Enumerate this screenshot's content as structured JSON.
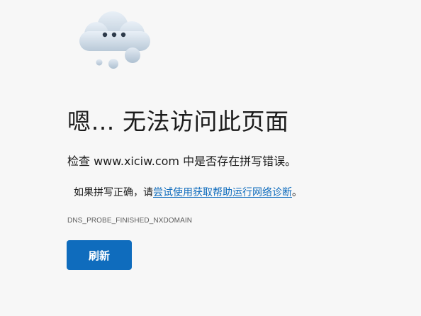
{
  "page": {
    "title": "嗯… 无法访问此页面",
    "check_line": "检查 www.xiciw.com 中是否存在拼写错误。",
    "suggestion_prefix": "如果拼写正确，请",
    "suggestion_link": "尝试使用获取帮助运行网络诊断",
    "suggestion_suffix": "。",
    "error_code": "DNS_PROBE_FINISHED_NXDOMAIN",
    "refresh_label": "刷新"
  },
  "icons": {
    "illustration": "cloud-thinking-icon"
  },
  "colors": {
    "background": "#f7f7f7",
    "text": "#1b1b1b",
    "link": "#0f6cbd",
    "button": "#0f6cbd",
    "button_text": "#ffffff",
    "error_code": "#5c5c5c"
  }
}
